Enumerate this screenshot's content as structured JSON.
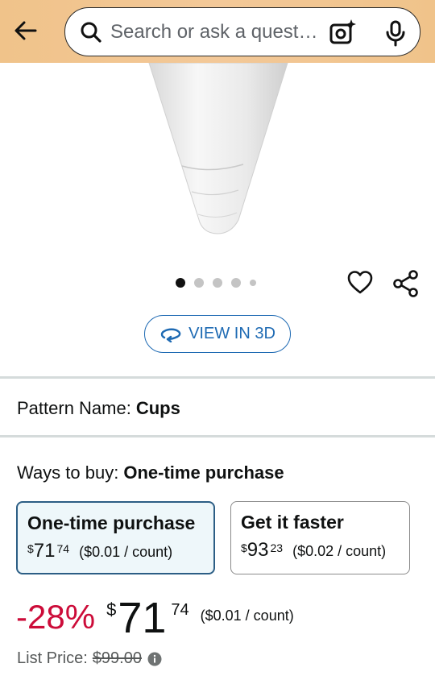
{
  "header": {
    "search_placeholder": "Search or ask a question",
    "icons": [
      "back-arrow-icon",
      "search-icon",
      "camera-sparkle-icon",
      "microphone-icon"
    ]
  },
  "carousel": {
    "dot_count": 5,
    "active_index": 0
  },
  "actions": {
    "view_3d_label": "VIEW IN 3D",
    "icons": [
      "heart-icon",
      "share-icon",
      "rotate-3d-icon"
    ]
  },
  "pattern": {
    "label": "Pattern Name:",
    "value": "Cups"
  },
  "ways_to_buy": {
    "label": "Ways to buy:",
    "value": "One-time purchase",
    "options": [
      {
        "title": "One-time purchase",
        "currency": "$",
        "whole": "71",
        "fraction": "74",
        "unit_price": "($0.01 / count)",
        "selected": true
      },
      {
        "title": "Get it faster",
        "currency": "$",
        "whole": "93",
        "fraction": "23",
        "unit_price": "($0.02 / count)",
        "selected": false
      }
    ]
  },
  "price": {
    "discount": "-28%",
    "currency": "$",
    "whole": "71",
    "fraction": "74",
    "unit_price": "($0.01 / count)",
    "list_price_label": "List Price:",
    "list_price_value": "$99.00"
  },
  "colors": {
    "header_bg": "#f0c38a",
    "accent_blue": "#1e6ab3",
    "selected_border": "#2c5e85",
    "discount_red": "#cc0c39"
  }
}
